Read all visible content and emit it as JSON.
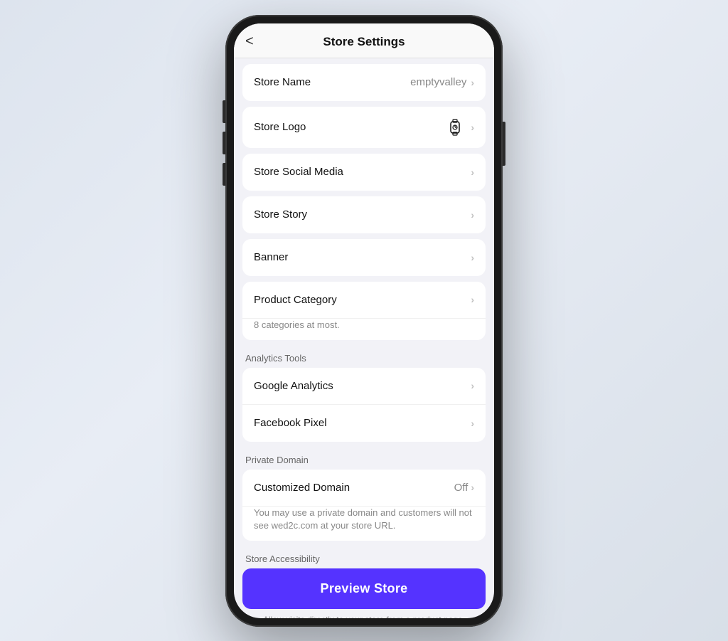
{
  "header": {
    "title": "Store Settings",
    "back_label": "<"
  },
  "rows": [
    {
      "id": "store-name",
      "label": "Store Name",
      "value": "emptyvalley",
      "hasChevron": true
    },
    {
      "id": "store-logo",
      "label": "Store Logo",
      "value": "",
      "hasLogo": true,
      "hasChevron": true
    },
    {
      "id": "store-social-media",
      "label": "Store Social Media",
      "value": "",
      "hasChevron": true
    },
    {
      "id": "store-story",
      "label": "Store Story",
      "value": "",
      "hasChevron": true
    },
    {
      "id": "banner",
      "label": "Banner",
      "value": "",
      "hasChevron": true
    }
  ],
  "product_category": {
    "label": "Product Category",
    "sub": "8 categories at most."
  },
  "analytics": {
    "section_label": "Analytics Tools",
    "google": {
      "label": "Google Analytics"
    },
    "facebook": {
      "label": "Facebook Pixel"
    }
  },
  "private_domain": {
    "section_label": "Private Domain",
    "label": "Customized Domain",
    "value": "Off",
    "sub": "You may use a private domain and customers will not see wed2c.com at your store URL."
  },
  "accessibility": {
    "section_label": "Store Accessibility",
    "preview_btn": "Preview Store",
    "preview_sub": "Allow visits directly to your store from a product page."
  }
}
